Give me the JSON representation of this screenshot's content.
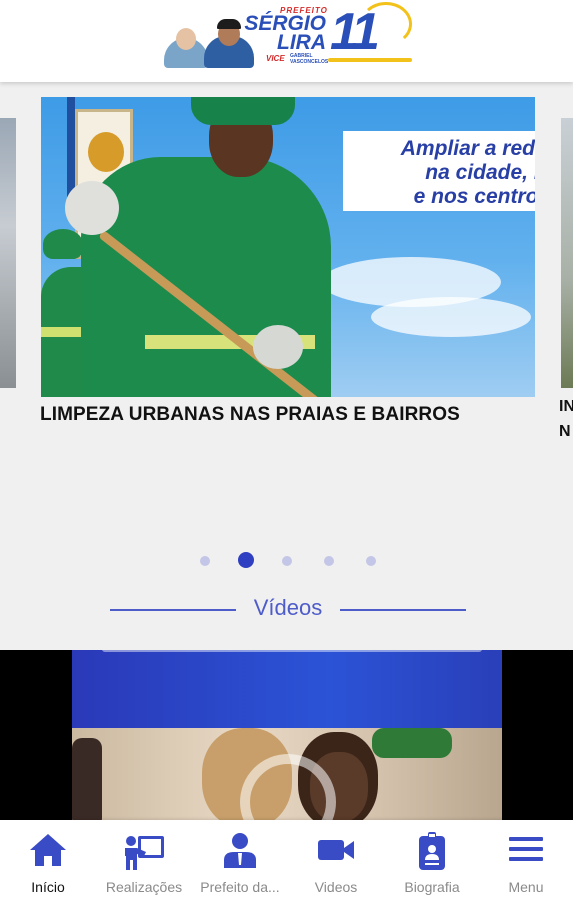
{
  "header": {
    "logo": {
      "prefeito": "PREFEITO",
      "name_line1": "SÉRGIO",
      "name_line2": "LIRA",
      "number": "11",
      "vice": "VICE",
      "vice_name_line1": "GABRIEL",
      "vice_name_line2": "VASCONCELOS"
    }
  },
  "carousel": {
    "slides": [
      {
        "overlay_lines": [
          "Ampliar a rede de",
          "na cidade, no li",
          "e nos centros ur"
        ],
        "caption": "LIMPEZA URBANAS NAS PRAIAS E BAIRROS"
      }
    ],
    "next_caption_lines": [
      "IN",
      "N"
    ],
    "dots_count": 5,
    "active_dot": 1
  },
  "videos_section": {
    "title": "Vídeos"
  },
  "bottom_nav": {
    "items": [
      {
        "label": "Início",
        "icon": "home-icon",
        "active": true
      },
      {
        "label": "Realizações",
        "icon": "presentation-icon",
        "active": false
      },
      {
        "label": "Prefeito da...",
        "icon": "person-icon",
        "active": false
      },
      {
        "label": "Videos",
        "icon": "video-camera-icon",
        "active": false
      },
      {
        "label": "Biografia",
        "icon": "id-badge-icon",
        "active": false
      },
      {
        "label": "Menu",
        "icon": "menu-icon",
        "active": false
      }
    ]
  },
  "colors": {
    "accent": "#2f3fc2",
    "section_title": "#4e5cc9",
    "nav_icon": "#3a4bc6"
  }
}
